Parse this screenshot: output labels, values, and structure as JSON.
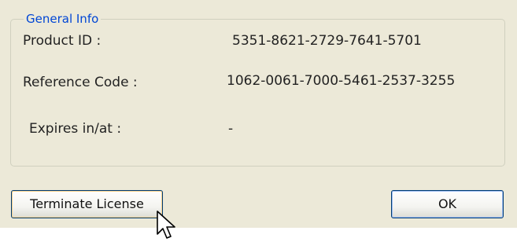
{
  "group": {
    "title": "General Info"
  },
  "fields": [
    {
      "label": "Product ID :",
      "value": "5351-8621-2729-7641-5701"
    },
    {
      "label": "Reference Code :",
      "value": "1062-0061-7000-5461-2537-3255"
    },
    {
      "label": "Expires in/at :",
      "value": "-"
    }
  ],
  "buttons": {
    "terminate_label": "Terminate License",
    "ok_label": "OK"
  },
  "colors": {
    "dialog_bg": "#ece9d8",
    "group_title": "#0046d5",
    "button_border": "#003c74"
  },
  "cursor": {
    "icon": "arrow-pointer-icon"
  }
}
